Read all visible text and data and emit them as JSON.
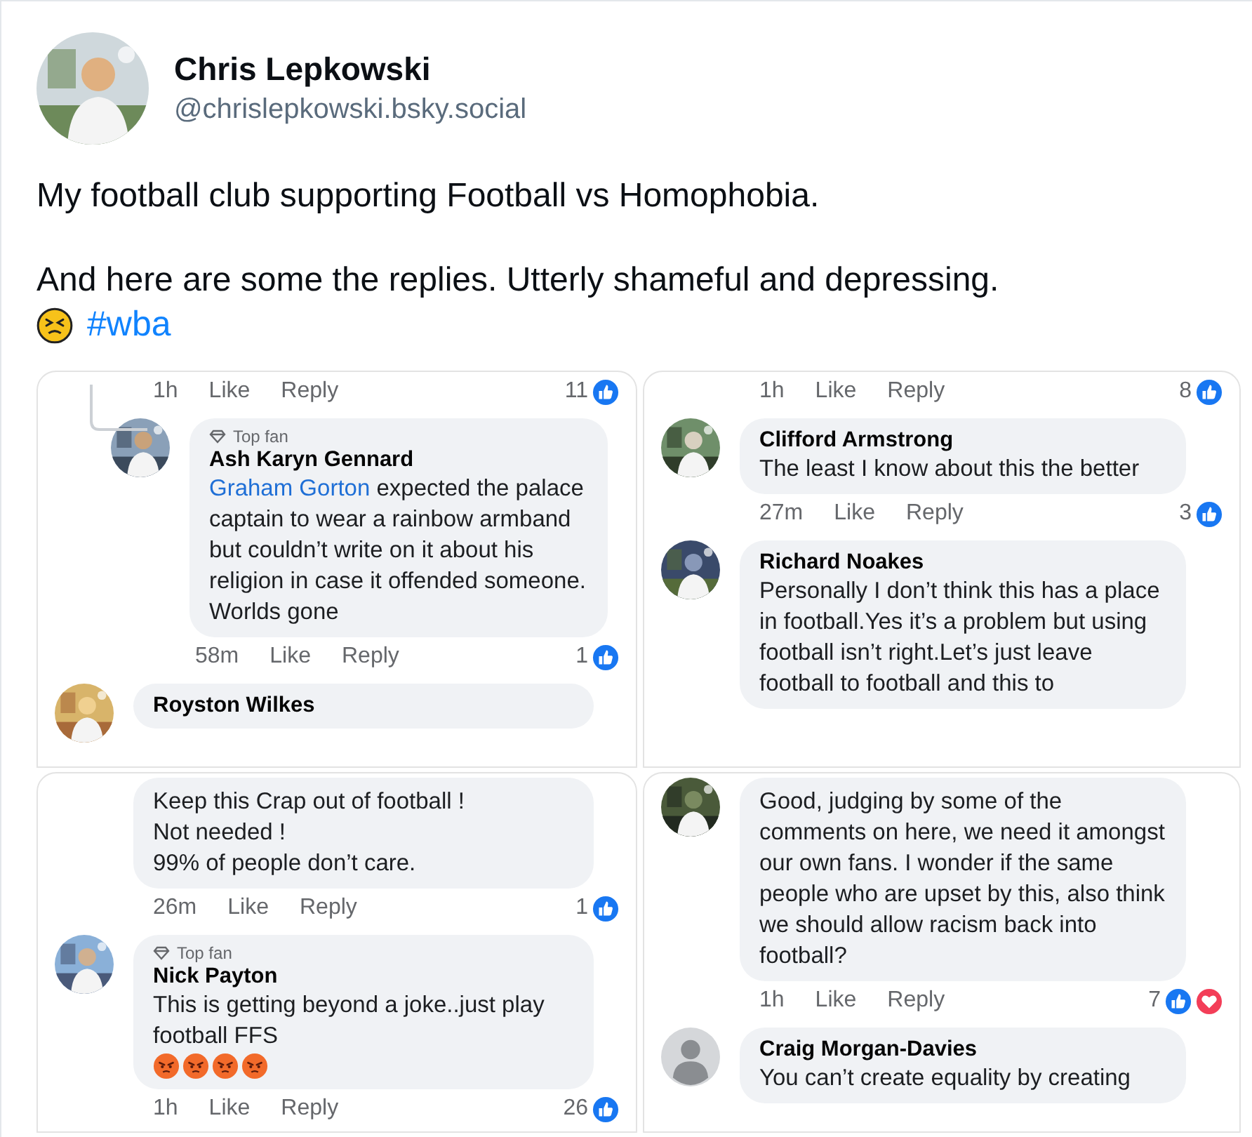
{
  "author": {
    "name": "Chris Lepkowski",
    "handle": "@chrislepkowski.bsky.social"
  },
  "post": {
    "paragraphs": [
      "My football club supporting Football vs Homophobia.",
      "And here are some the replies. Utterly shameful and depressing."
    ],
    "hashtag": "#wba"
  },
  "screenshots": [
    {
      "items": [
        {
          "kind": "meta",
          "time": "1h",
          "like": "Like",
          "reply": "Reply",
          "count": "11",
          "reactions": [
            {
              "kind": "like"
            }
          ]
        },
        {
          "kind": "comment",
          "reply": true,
          "badge": "Top fan",
          "name": "Ash Karyn Gennard",
          "mention": "Graham Gorton",
          "text": "expected the palace captain to wear a rainbow armband but couldn’t write on it about his religion in case it offended someone. Worlds gone"
        },
        {
          "kind": "meta",
          "reply_thread": true,
          "time": "58m",
          "like": "Like",
          "reply": "Reply",
          "count": "1",
          "reactions": [
            {
              "kind": "like"
            }
          ]
        },
        {
          "kind": "comment",
          "reply": false,
          "name": "Royston Wilkes"
        }
      ]
    },
    {
      "items": [
        {
          "kind": "meta",
          "time": "1h",
          "like": "Like",
          "reply": "Reply",
          "count": "8",
          "reactions": [
            {
              "kind": "like"
            }
          ]
        },
        {
          "kind": "comment",
          "reply": false,
          "name": "Clifford Armstrong",
          "text": "The least I know about this the better"
        },
        {
          "kind": "meta",
          "time": "27m",
          "like": "Like",
          "reply": "Reply",
          "count": "3",
          "reactions": [
            {
              "kind": "like"
            }
          ]
        },
        {
          "kind": "comment",
          "reply": false,
          "name": "Richard Noakes",
          "text": "Personally I don’t think this has a place in football.Yes it’s a problem but using football isn’t right.Let’s just leave football to football and this to"
        }
      ]
    },
    {
      "items": [
        {
          "kind": "comment",
          "reply": false,
          "lines": [
            "Keep this Crap out of football !",
            "Not needed !",
            "99% of people don’t care."
          ]
        },
        {
          "kind": "meta",
          "time": "26m",
          "like": "Like",
          "reply": "Reply",
          "count": "1",
          "reactions": [
            {
              "kind": "like"
            }
          ]
        },
        {
          "kind": "comment",
          "reply": false,
          "badge": "Top fan",
          "name": "Nick Payton",
          "text": "This is getting beyond a joke..just play football FFS",
          "emojis": [
            {
              "kind": "angry"
            },
            {
              "kind": "angry"
            },
            {
              "kind": "angry"
            },
            {
              "kind": "angry"
            }
          ]
        },
        {
          "kind": "meta",
          "time": "1h",
          "like": "Like",
          "reply": "Reply",
          "count": "26",
          "reactions": [
            {
              "kind": "like"
            }
          ]
        }
      ]
    },
    {
      "items": [
        {
          "kind": "comment",
          "reply": false,
          "text": "Good, judging by some of the comments on here, we need it amongst our own fans. I wonder if the same people who are upset by this, also think we should allow racism back into football?"
        },
        {
          "kind": "meta",
          "time": "1h",
          "like": "Like",
          "reply": "Reply",
          "count": "7",
          "reactions": [
            {
              "kind": "like"
            },
            {
              "kind": "love"
            }
          ]
        },
        {
          "kind": "comment",
          "reply": false,
          "avatar": {
            "kind": "default"
          },
          "name": "Craig Morgan-Davies",
          "text": "You can’t create equality by creating"
        }
      ]
    }
  ]
}
